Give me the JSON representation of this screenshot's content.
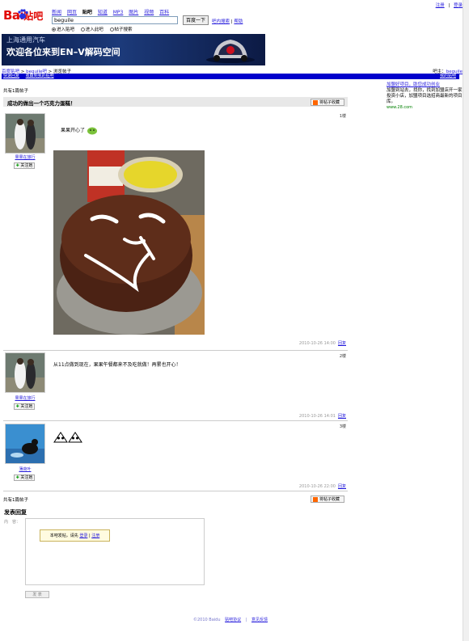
{
  "top_links": [
    "注册",
    "登录"
  ],
  "logo": {
    "bai": "Bai",
    "text": "贴吧"
  },
  "nav": [
    "新闻",
    "网页",
    "贴吧",
    "知道",
    "MP3",
    "图片",
    "视频",
    "百科"
  ],
  "nav_current": "贴吧",
  "search": {
    "value": "beguile",
    "button": "百度一下",
    "links": [
      "吧内搜索",
      "帮助"
    ]
  },
  "radios": [
    {
      "label": "进入贴吧",
      "checked": true
    },
    {
      "label": "进入此吧",
      "checked": false
    },
    {
      "label": "帖子搜索",
      "checked": false
    }
  ],
  "banner": {
    "line1": "上海通用汽车",
    "line2": "欢迎各位来到EN–V解码空间"
  },
  "breadcrumb": [
    "百度贴吧",
    "beguile吧",
    "浏览帖子"
  ],
  "login": {
    "prefix": "吧主：",
    "link": "beguile"
  },
  "bluebar": {
    "left": [
      "快速回复",
      "收藏到我的贴吧"
    ],
    "right": "我的贴吧"
  },
  "side": {
    "title": "加盟好项目，助您成功创业",
    "text": "加盟到站去，找你，找到加盟店开一家投资小店，加盟项目选招商最新的项目库。",
    "url": "www.28.com"
  },
  "thread": {
    "count_top": "共有1篇帖子",
    "count_bottom": "共有1篇帖子",
    "title": "成功的做出一个巧克力蛋糕！",
    "rss": "将帖子收藏"
  },
  "posts": [
    {
      "floor": "1楼",
      "user": "果果在旅行",
      "follow": "关注她",
      "text": "果果开心了",
      "time": "2010-10-26 14:00",
      "reply": "回复"
    },
    {
      "floor": "2楼",
      "user": "果果在旅行",
      "follow": "关注她",
      "text": "从11点做到现在，果果午餐都来不及吃就做！再累也开心！",
      "time": "2010-10-26 14:01",
      "reply": "回复"
    },
    {
      "floor": "3楼",
      "user": "薄荷叶",
      "follow": "关注她",
      "text": "",
      "time": "2010-10-26 22:00",
      "reply": "回复"
    }
  ],
  "reply": {
    "title": "发表回复",
    "label": "内　容：",
    "popup_text": "本吧发帖，请先",
    "popup_login": "登录",
    "popup_sep": "|",
    "popup_register": "注册",
    "submit": "发 表"
  },
  "footer": [
    "©2010 Baidu",
    "贴吧协议",
    "意见反馈"
  ],
  "colors": {
    "link": "#261cdc",
    "bluebar": "#0000cc",
    "thread_bg": "#e8e8e8",
    "logo_red": "#e10602"
  }
}
